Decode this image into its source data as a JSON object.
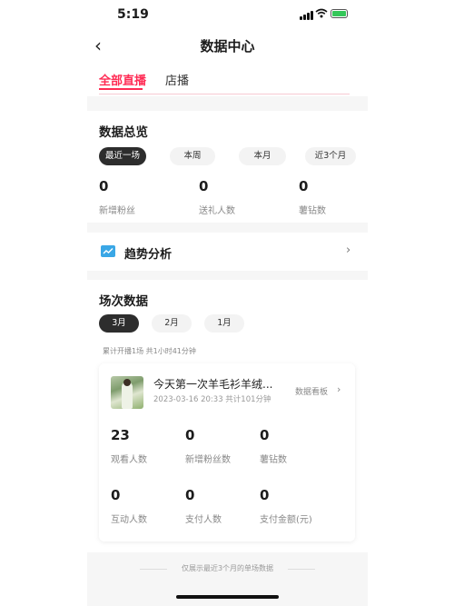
{
  "status_bar": {
    "time": "5:19"
  },
  "nav": {
    "title": "数据中心",
    "back_glyph": "‹"
  },
  "tabs": [
    {
      "label": "全部直播"
    },
    {
      "label": "店播"
    }
  ],
  "overview": {
    "title": "数据总览",
    "filters": [
      {
        "label": "最近一场",
        "selected": true
      },
      {
        "label": "本周",
        "selected": false
      },
      {
        "label": "本月",
        "selected": false
      },
      {
        "label": "近3个月",
        "selected": false
      }
    ],
    "metrics": [
      {
        "value": "0",
        "label": "新增粉丝"
      },
      {
        "value": "0",
        "label": "送礼人数"
      },
      {
        "value": "0",
        "label": "薯钻数"
      }
    ]
  },
  "trend": {
    "label": "趋势分析",
    "chevron": "›"
  },
  "sessions": {
    "title": "场次数据",
    "months": [
      {
        "label": "3月",
        "selected": true
      },
      {
        "label": "2月",
        "selected": false
      },
      {
        "label": "1月",
        "selected": false
      }
    ],
    "summary": "累计开播1场 共1小时41分钟",
    "card": {
      "title": "今天第一次羊毛衫羊绒...",
      "subtitle": "2023-03-16 20:33  共计101分钟",
      "board_label": "数据看板",
      "board_chevron": "›",
      "metrics": [
        {
          "value": "23",
          "label": "观看人数"
        },
        {
          "value": "0",
          "label": "新增粉丝数"
        },
        {
          "value": "0",
          "label": "薯钻数"
        },
        {
          "value": "0",
          "label": "互动人数"
        },
        {
          "value": "0",
          "label": "支付人数"
        },
        {
          "value": "0",
          "label": "支付金额(元)"
        }
      ]
    }
  },
  "footnote": "仅展示最近3个月的单场数据",
  "colors": {
    "accent": "#ff2b54",
    "dark_pill": "#2d2d2d",
    "trend_icon": "#3aa7e6"
  }
}
